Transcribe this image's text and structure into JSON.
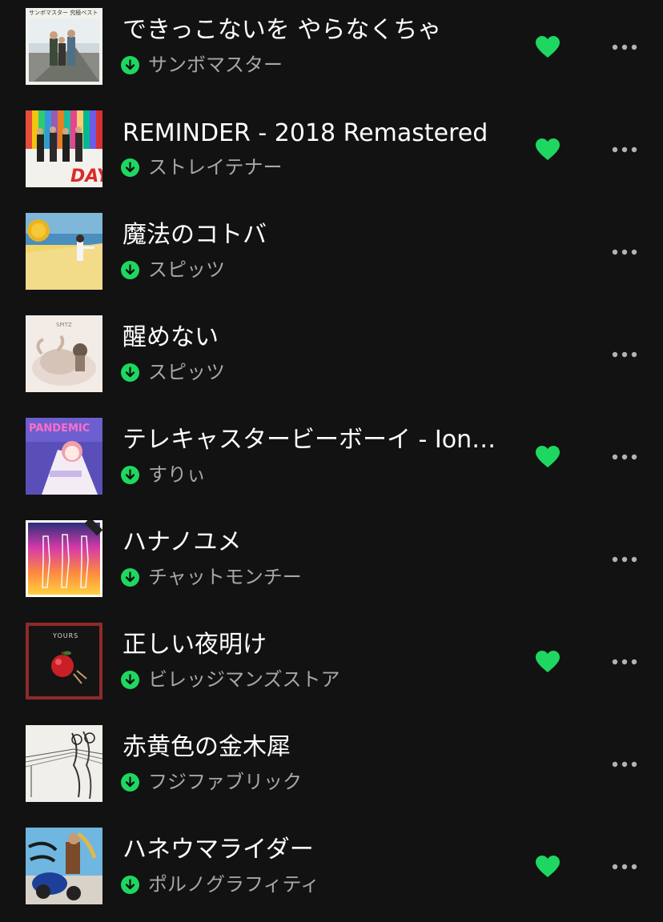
{
  "colors": {
    "background": "#121212",
    "title": "#ffffff",
    "artist": "#a7a7a7",
    "accent_green": "#1ed760",
    "more_dots": "#b3b3b3"
  },
  "tracks": [
    {
      "title": "できっこないを やらなくちゃ",
      "artist": "サンボマスター",
      "liked": true,
      "downloaded": true,
      "cover_text": "サンボマスター 究極ベスト",
      "cover_icon": "album-cover-photo-beach"
    },
    {
      "title": "REMINDER - 2018 Remastered",
      "artist": "ストレイテナー",
      "liked": true,
      "downloaded": true,
      "cover_text": "DAY",
      "cover_icon": "album-cover-colorful-band"
    },
    {
      "title": "魔法のコトバ",
      "artist": "スピッツ",
      "liked": false,
      "downloaded": true,
      "cover_text": "",
      "cover_icon": "album-cover-sun-beach"
    },
    {
      "title": "醒めない",
      "artist": "スピッツ",
      "liked": false,
      "downloaded": true,
      "cover_text": "SPITZ",
      "cover_icon": "album-cover-bull"
    },
    {
      "title": "テレキャスタービーボーイ - Ion…",
      "artist": "すりぃ",
      "liked": true,
      "downloaded": true,
      "cover_text": "PANDEMIC",
      "cover_icon": "album-cover-anime"
    },
    {
      "title": "ハナノユメ",
      "artist": "チャットモンチー",
      "liked": false,
      "downloaded": true,
      "cover_text": "",
      "cover_icon": "album-cover-gradient-figures"
    },
    {
      "title": "正しい夜明け",
      "artist": "ビレッジマンズストア",
      "liked": true,
      "downloaded": true,
      "cover_text": "YOURS",
      "cover_icon": "album-cover-apple"
    },
    {
      "title": "赤黄色の金木犀",
      "artist": "フジファブリック",
      "liked": false,
      "downloaded": true,
      "cover_text": "",
      "cover_icon": "album-cover-sketch"
    },
    {
      "title": "ハネウマライダー",
      "artist": "ポルノグラフィティ",
      "liked": true,
      "downloaded": true,
      "cover_text": "",
      "cover_icon": "album-cover-motorcycle"
    }
  ]
}
